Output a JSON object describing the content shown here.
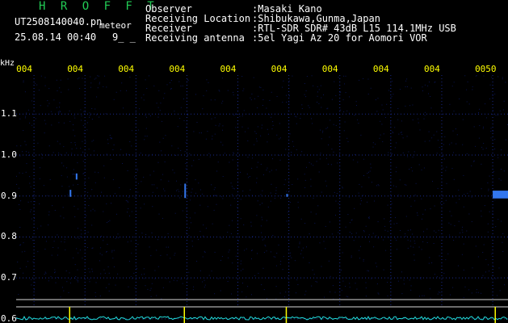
{
  "header": {
    "brand": "H R O F F T",
    "file_name": "UT2508140040.pn",
    "meteor_label": "meteor",
    "date_time": "25.08.14 00:40",
    "marker": "9_ _",
    "info": [
      {
        "label": "Observer",
        "value": ":Masaki Kano"
      },
      {
        "label": "Receiving Location",
        "value": ":Shibukawa,Gunma,Japan"
      },
      {
        "label": "Receiver",
        "value": ":RTL-SDR SDR# 43dB L15 114.1MHz USB"
      },
      {
        "label": "Receiving antenna",
        "value": ":5el Yagi Az 20 for Aomori VOR"
      }
    ]
  },
  "colors": {
    "brand": "#22cc55",
    "text": "#ffffff",
    "axis": "#ffff00",
    "grid": "#1a2a8a",
    "noise": "#0a1450",
    "echo": "#3377ee",
    "spectrum": "#22dddd",
    "spike": "#ffff00",
    "baseline": "#d8d8d8"
  },
  "chart_data": {
    "type": "heatmap",
    "ylabel": "kHz",
    "y_ticks": [
      "1.1",
      "1.0",
      "0.9",
      "0.8",
      "0.7",
      "0.6"
    ],
    "y_tick_values": [
      1.1,
      1.0,
      0.9,
      0.8,
      0.7,
      0.6
    ],
    "x_ticks": [
      "004",
      "004",
      "004",
      "004",
      "004",
      "004",
      "004",
      "004",
      "004",
      "0050"
    ],
    "x_tick_values": [
      0,
      1,
      2,
      3,
      4,
      5,
      6,
      7,
      8,
      9
    ],
    "xlim": [
      -0.35,
      9.3
    ],
    "ylim": [
      0.59,
      1.195
    ],
    "echoes": [
      {
        "x": 0.7,
        "y_low": 0.898,
        "y_high": 0.915
      },
      {
        "x": 0.82,
        "y_low": 0.94,
        "y_high": 0.955
      },
      {
        "x": 2.95,
        "y_low": 0.895,
        "y_high": 0.93
      },
      {
        "x": 4.95,
        "y_low": 0.898,
        "y_high": 0.905
      },
      {
        "x": 9.0,
        "x_end": 9.65,
        "y_low": 0.894,
        "y_high": 0.913
      }
    ],
    "spectrum_spikes": [
      0.7,
      2.95,
      4.95,
      9.05,
      9.35
    ]
  }
}
